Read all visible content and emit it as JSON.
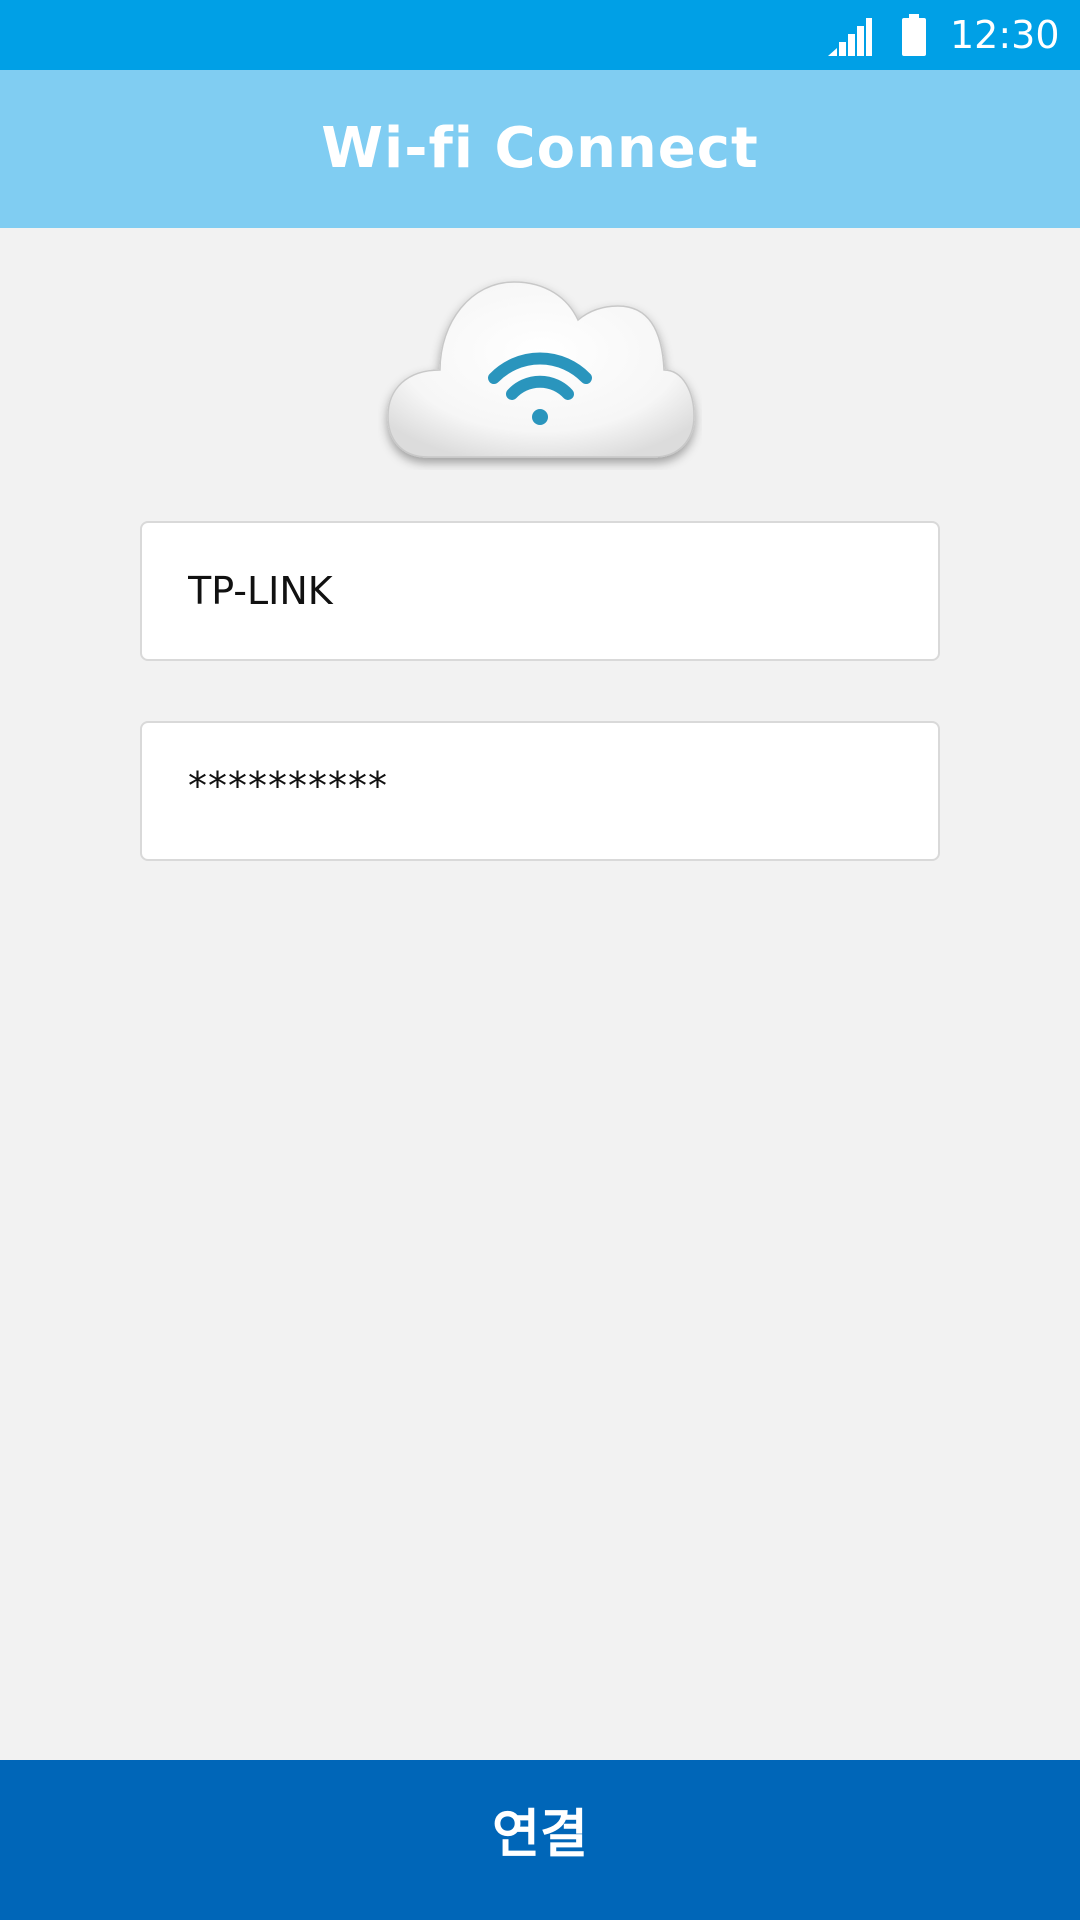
{
  "status_bar": {
    "time": "12:30",
    "signal_icon": "signal-strength-icon",
    "battery_icon": "battery-icon",
    "background_color": "#00a0e6"
  },
  "app_bar": {
    "title": "Wi-fi Connect",
    "background_color": "#80cdf2"
  },
  "illustration": {
    "icon": "cloud-wifi-icon",
    "wifi_color": "#2a95bd"
  },
  "form": {
    "ssid_value": "TP-LINK",
    "password_value": "**********"
  },
  "connect_button": {
    "label": "연결",
    "background_color": "#0066b8"
  },
  "page_background": "#f2f2f2"
}
